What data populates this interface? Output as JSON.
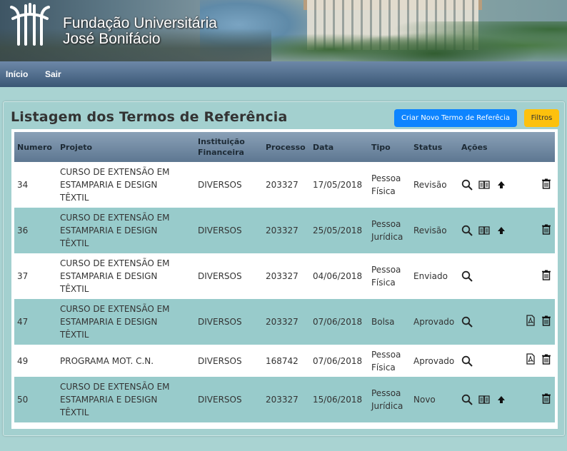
{
  "brand": {
    "line1": "Fundação Universitária",
    "line2": "José Bonifácio"
  },
  "nav": {
    "home": "Início",
    "logout": "Sair"
  },
  "page": {
    "title": "Listagem dos Termos de Referência",
    "new_button": "Criar Novo Termo de Referêcia",
    "filter_button": "Filtros"
  },
  "table": {
    "headers": {
      "numero": "Numero",
      "projeto": "Projeto",
      "instituicao_1": "Instituição",
      "instituicao_2": "Financeira",
      "processo": "Processo",
      "data": "Data",
      "tipo": "Tipo",
      "status": "Status",
      "acoes": "Ações"
    },
    "rows": [
      {
        "numero": "34",
        "projeto_1": "CURSO DE EXTENSÃO EM",
        "projeto_2": "ESTAMPARIA E DESIGN",
        "projeto_3": "TÊXTIL",
        "instituicao": "DIVERSOS",
        "processo": "203327",
        "data": "17/05/2018",
        "tipo_1": "Pessoa",
        "tipo_2": "Física",
        "status": "Revisão"
      },
      {
        "numero": "36",
        "projeto_1": "CURSO DE EXTENSÃO EM",
        "projeto_2": "ESTAMPARIA E DESIGN",
        "projeto_3": "TÊXTIL",
        "instituicao": "DIVERSOS",
        "processo": "203327",
        "data": "25/05/2018",
        "tipo_1": "Pessoa",
        "tipo_2": "Jurídica",
        "status": "Revisão"
      },
      {
        "numero": "37",
        "projeto_1": "CURSO DE EXTENSÃO EM",
        "projeto_2": "ESTAMPARIA E DESIGN",
        "projeto_3": "TÊXTIL",
        "instituicao": "DIVERSOS",
        "processo": "203327",
        "data": "04/06/2018",
        "tipo_1": "Pessoa",
        "tipo_2": "Física",
        "status": "Enviado"
      },
      {
        "numero": "47",
        "projeto_1": "CURSO DE EXTENSÃO EM",
        "projeto_2": "ESTAMPARIA E DESIGN",
        "projeto_3": "TÊXTIL",
        "instituicao": "DIVERSOS",
        "processo": "203327",
        "data": "07/06/2018",
        "tipo_1": "Bolsa",
        "tipo_2": "",
        "status": "Aprovado"
      },
      {
        "numero": "49",
        "projeto_1": "PROGRAMA MOT. C.N.",
        "projeto_2": "",
        "projeto_3": "",
        "instituicao": "DIVERSOS",
        "processo": "168742",
        "data": "07/06/2018",
        "tipo_1": "Pessoa",
        "tipo_2": "Física",
        "status": "Aprovado"
      },
      {
        "numero": "50",
        "projeto_1": "CURSO DE EXTENSÃO EM",
        "projeto_2": "ESTAMPARIA E DESIGN",
        "projeto_3": "TÊXTIL",
        "instituicao": "DIVERSOS",
        "processo": "203327",
        "data": "15/06/2018",
        "tipo_1": "Pessoa",
        "tipo_2": "Jurídica",
        "status": "Novo"
      }
    ]
  }
}
